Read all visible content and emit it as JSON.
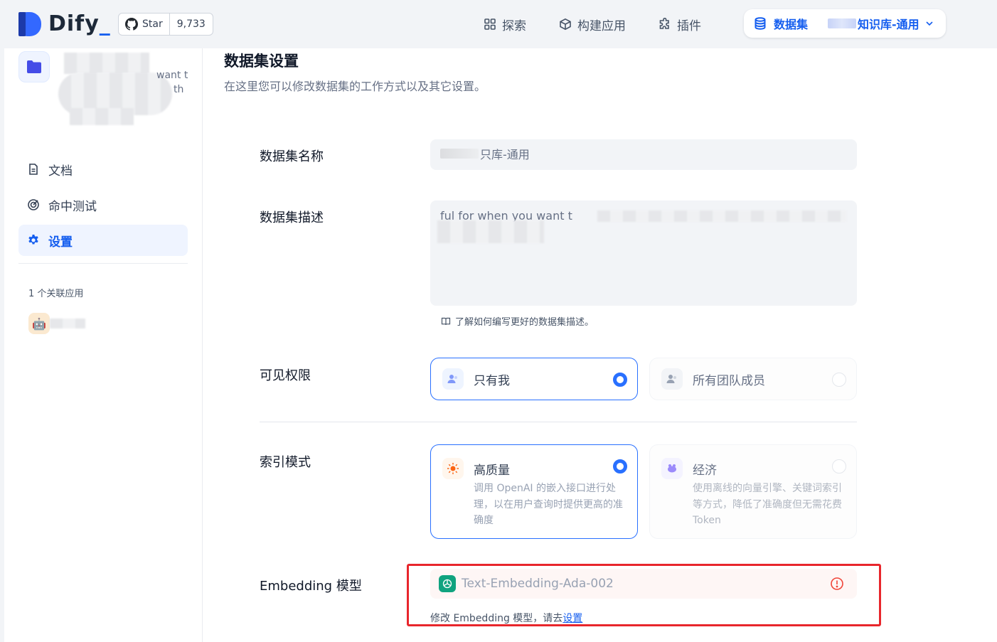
{
  "header": {
    "logo_text": "Dify",
    "github_star_label": "Star",
    "github_star_count": "9,733",
    "nav": [
      {
        "label": "探索",
        "icon": "grid-icon"
      },
      {
        "label": "构建应用",
        "icon": "cube-icon"
      },
      {
        "label": "插件",
        "icon": "puzzle-icon"
      }
    ],
    "active_nav": {
      "label": "数据集",
      "icon": "database-icon",
      "dataset_suffix": "知识库-通用"
    }
  },
  "sidebar": {
    "desc_fragment_1": "want t",
    "desc_fragment_2": "th",
    "items": [
      {
        "label": "文档",
        "icon": "document-icon"
      },
      {
        "label": "命中测试",
        "icon": "target-icon"
      },
      {
        "label": "设置",
        "icon": "gear-icon"
      }
    ],
    "related_apps": "1 个关联应用"
  },
  "main": {
    "title": "数据集设置",
    "subtitle": "在这里您可以修改数据集的工作方式以及其它设置。",
    "name_label": "数据集名称",
    "name_value": "只库-通用",
    "desc_label": "数据集描述",
    "desc_value": "ful for when you want t",
    "desc_hint": "了解如何编写更好的数据集描述。",
    "visibility_label": "可见权限",
    "visibility_options": [
      {
        "label": "只有我",
        "selected": true
      },
      {
        "label": "所有团队成员",
        "selected": false
      }
    ],
    "index_label": "索引模式",
    "index_options": [
      {
        "label": "高质量",
        "desc": "调用 OpenAI 的嵌入接口进行处理，以在用户查询时提供更高的准确度",
        "selected": true
      },
      {
        "label": "经济",
        "desc": "使用离线的向量引擎、关键词索引等方式，降低了准确度但无需花费 Token",
        "selected": false
      }
    ],
    "embedding_label": "Embedding 模型",
    "embedding_value": "Text-Embedding-Ada-002",
    "embedding_hint_prefix": "修改 Embedding 模型，请去",
    "embedding_hint_link": "设置"
  },
  "colors": {
    "accent": "#155eef",
    "highlight_box": "#e8262c",
    "warning": "#f04438"
  }
}
